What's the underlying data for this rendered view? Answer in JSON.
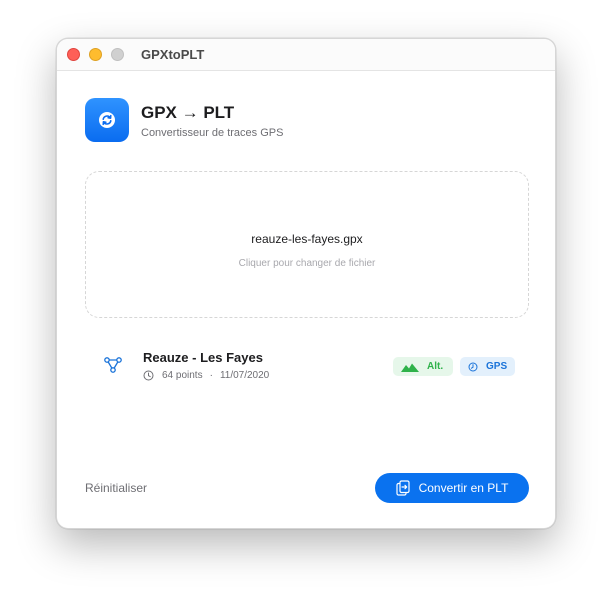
{
  "window": {
    "title": "GPXtoPLT"
  },
  "header": {
    "app_icon": "refresh-icon",
    "title": "GPX → PLT",
    "subtitle": "Convertisseur de traces GPS"
  },
  "dropzone": {
    "file_name": "reauze-les-fayes.gpx",
    "hint": "Cliquer pour changer de fichier"
  },
  "track": {
    "icon": "route-icon",
    "name": "Reauze - Les Fayes",
    "points": "64 points",
    "separator": "·",
    "date": "11/07/2020",
    "badges": [
      {
        "label": "Alt.",
        "icon": "mountain-icon",
        "color": "#2fb24a",
        "bg": "#e6f7ea"
      },
      {
        "label": "GPS",
        "icon": "clock-icon",
        "color": "#1a73d9",
        "bg": "#e3f0fc"
      }
    ]
  },
  "footer": {
    "reset_label": "Réinitialiser",
    "convert_label": "Convertir en PLT",
    "convert_icon": "export-file-icon"
  },
  "colors": {
    "accent": "#0a72ef",
    "close": "#fe5f57",
    "minimize": "#febc2e",
    "disabled": "#d0d0d0"
  }
}
